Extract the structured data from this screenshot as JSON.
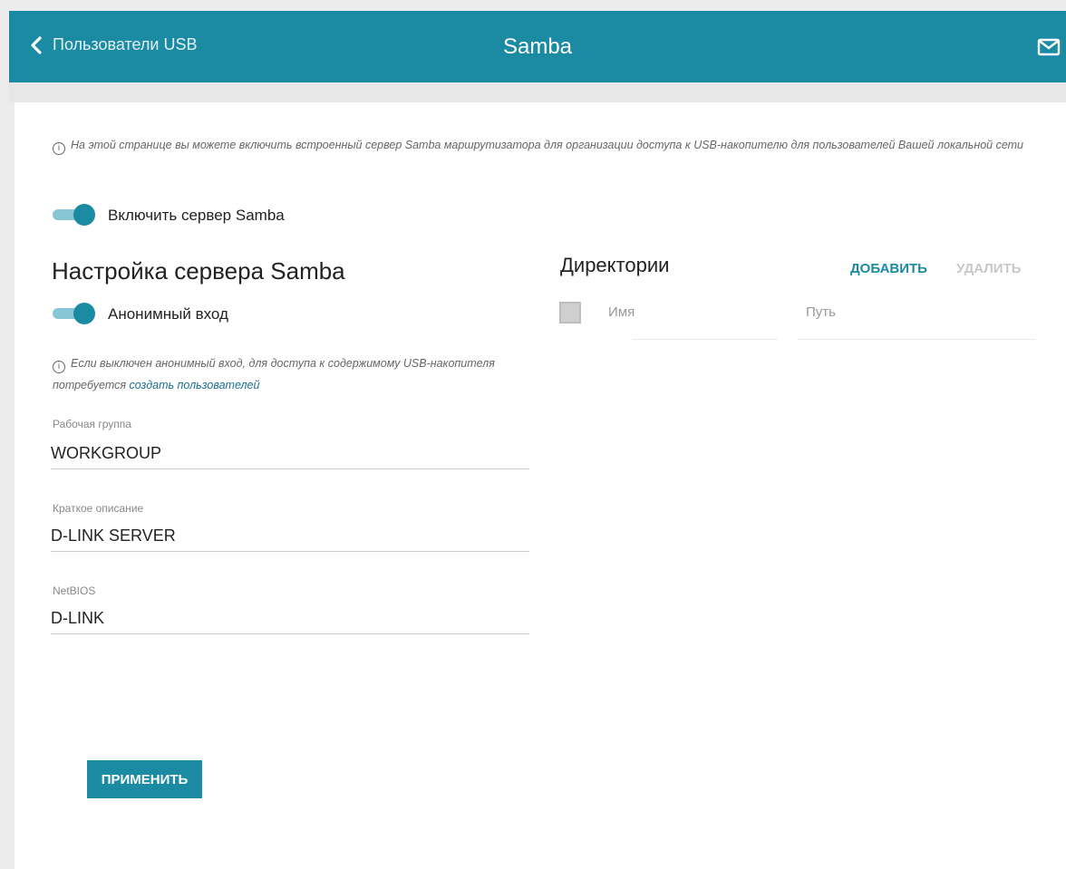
{
  "header": {
    "back_label": "Пользователи USB",
    "title": "Samba",
    "icons": {
      "back": "chevron-left-icon",
      "mail": "mail-icon"
    }
  },
  "info_top": "На этой странице вы можете включить встроенный сервер Samba маршрутизатора для организации доступа к USB-накопителю для пользователей Вашей локальной сети",
  "enable_samba": {
    "label": "Включить сервер Samba",
    "checked": true
  },
  "settings": {
    "heading": "Настройка сервера Samba",
    "anonymous": {
      "label": "Анонимный вход",
      "checked": true
    },
    "info_text": "Если выключен анонимный вход, для доступа к содержимому USB-накопителя потребуется ",
    "info_link": "создать пользователей",
    "workgroup": {
      "label": "Рабочая группа",
      "value": "WORKGROUP"
    },
    "description": {
      "label": "Краткое описание",
      "value": "D-LINK SERVER"
    },
    "netbios": {
      "label": "NetBIOS",
      "value": "D-LINK"
    },
    "apply_label": "ПРИМЕНИТЬ"
  },
  "directories": {
    "heading": "Директории",
    "add_label": "ДОБАВИТЬ",
    "delete_label": "УДАЛИТЬ",
    "columns": [
      "Имя",
      "Путь"
    ],
    "rows": []
  },
  "colors": {
    "accent": "#1b8aa3",
    "toggle_track": "#86c6d5",
    "disabled": "#c8c8c8"
  }
}
